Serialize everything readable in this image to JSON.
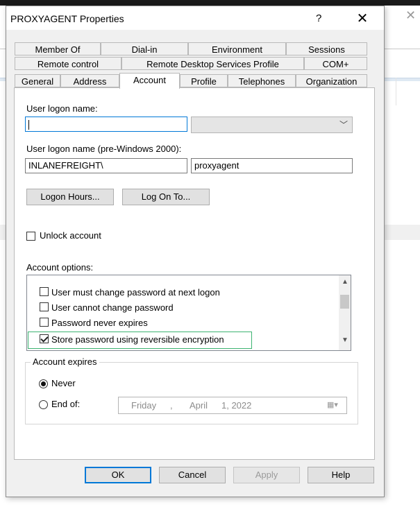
{
  "window": {
    "title": "PROXYAGENT Properties",
    "help": "?",
    "close": "✕"
  },
  "tabs": {
    "row1": [
      "Member Of",
      "Dial-in",
      "Environment",
      "Sessions"
    ],
    "row2": [
      "Remote control",
      "Remote Desktop Services Profile",
      "COM+"
    ],
    "row3": [
      "General",
      "Address",
      "Account",
      "Profile",
      "Telephones",
      "Organization"
    ],
    "active": "Account"
  },
  "account": {
    "logon_label": "User logon name:",
    "logon_value": "",
    "prewin_label": "User logon name (pre-Windows 2000):",
    "domain_value": "INLANEFREIGHT\\",
    "user_value": "proxyagent",
    "logon_hours_btn": "Logon Hours...",
    "logon_to_btn": "Log On To...",
    "unlock_label": "Unlock account",
    "options_label": "Account options:",
    "options": [
      {
        "label": "User must change password at next logon",
        "checked": false
      },
      {
        "label": "User cannot change password",
        "checked": false
      },
      {
        "label": "Password never expires",
        "checked": false
      },
      {
        "label": "Store password using reversible encryption",
        "checked": true
      }
    ],
    "expires_label": "Account expires",
    "never_label": "Never",
    "endof_label": "End of:",
    "date": {
      "day": "Friday",
      "month": "April",
      "daynum": "1, 2022",
      "sep": ","
    }
  },
  "buttons": {
    "ok": "OK",
    "cancel": "Cancel",
    "apply": "Apply",
    "help": "Help"
  },
  "colors": {
    "focus": "#0078d7",
    "highlight": "#3cb371"
  }
}
